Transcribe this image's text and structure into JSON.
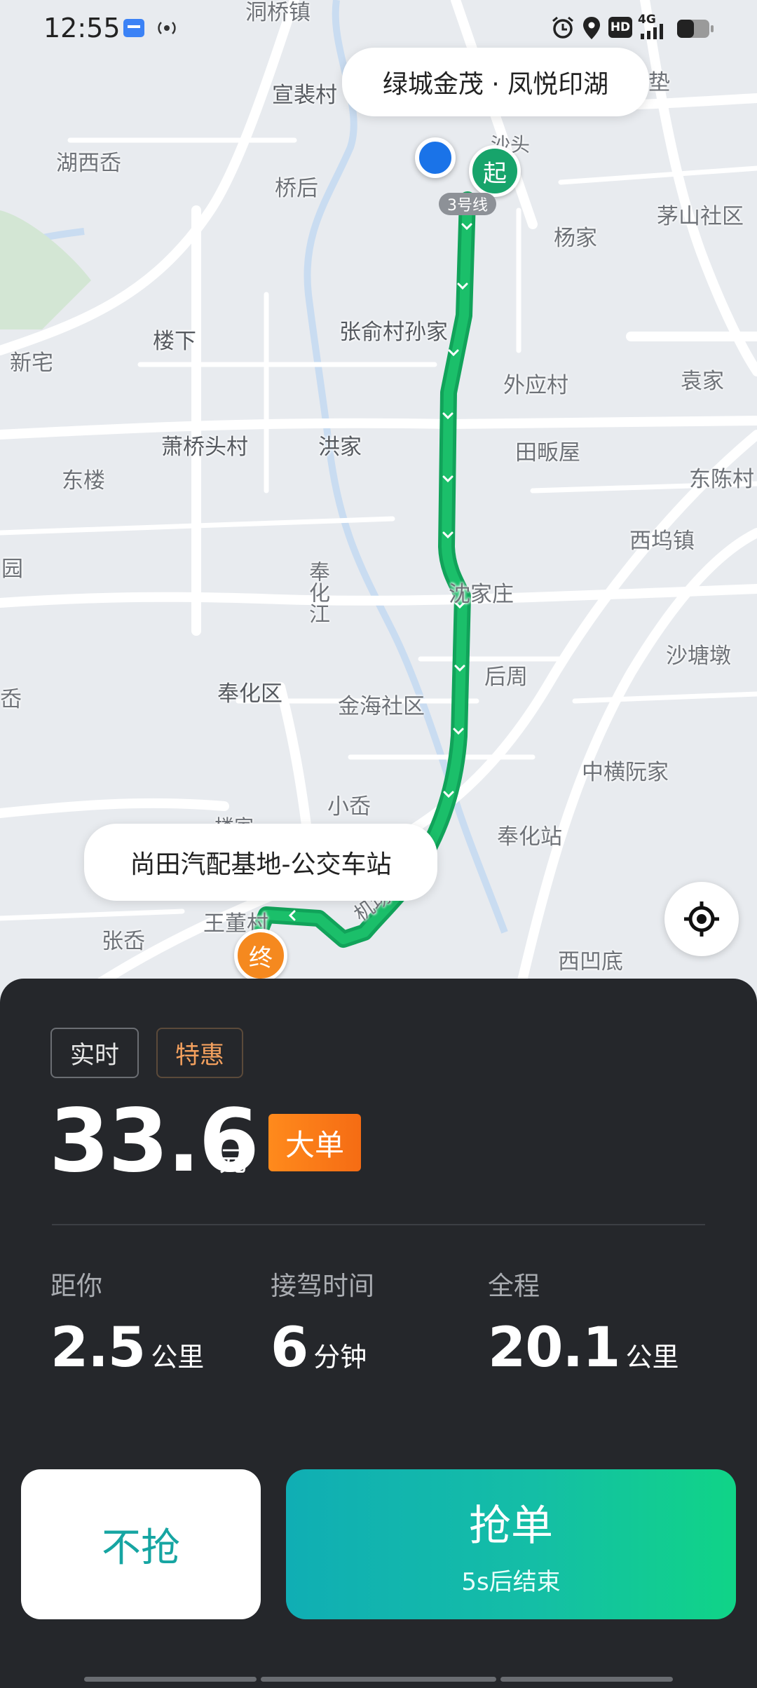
{
  "status_bar": {
    "time": "12:55",
    "icons": [
      "app-notification-icon",
      "hotspot-icon",
      "alarm-icon",
      "location-icon",
      "hd-icon",
      "signal-4g-icon",
      "battery-icon"
    ],
    "network_label": "4G",
    "hd_label": "HD"
  },
  "map": {
    "start_label": "绿城金茂 · 凤悦印湖",
    "end_label": "尚田汽配基地-公交车站",
    "start_pin": "起",
    "end_pin": "终",
    "exit_badge": "3号线",
    "route_color": "#11a35a",
    "places": [
      "洞桥镇",
      "宣裴村",
      "湖西岙",
      "桥后",
      "杨家",
      "茅山社区",
      "新宅",
      "楼下",
      "张俞村孙家",
      "外应村",
      "袁家",
      "萧桥头村",
      "洪家",
      "田畈屋",
      "东楼",
      "东陈村",
      "西坞镇",
      "园",
      "奉化江",
      "沈家庄",
      "沙塘墩",
      "岙",
      "奉化区",
      "金海社区",
      "后周",
      "中横阮家",
      "小岙",
      "奉化站",
      "王董村",
      "张岙",
      "西凹底",
      "机场路",
      "楼家",
      "沙头",
      "垫"
    ]
  },
  "order": {
    "tags": {
      "realtime": "实时",
      "discount": "特惠"
    },
    "price": "33.6",
    "price_unit": "元",
    "big_order_badge": "大单",
    "stats": {
      "distance": {
        "label": "距你",
        "value": "2.5",
        "unit": "公里"
      },
      "pickup_time": {
        "label": "接驾时间",
        "value": "6",
        "unit": "分钟"
      },
      "total": {
        "label": "全程",
        "value": "20.1",
        "unit": "公里"
      }
    },
    "skip_label": "不抢",
    "grab_label": "抢单",
    "grab_countdown": "5s后结束"
  },
  "colors": {
    "sheet_bg": "#25272b",
    "accent_teal": "#14bea6",
    "badge_orange": "#f5891f",
    "discount_text": "#f3a05e"
  }
}
